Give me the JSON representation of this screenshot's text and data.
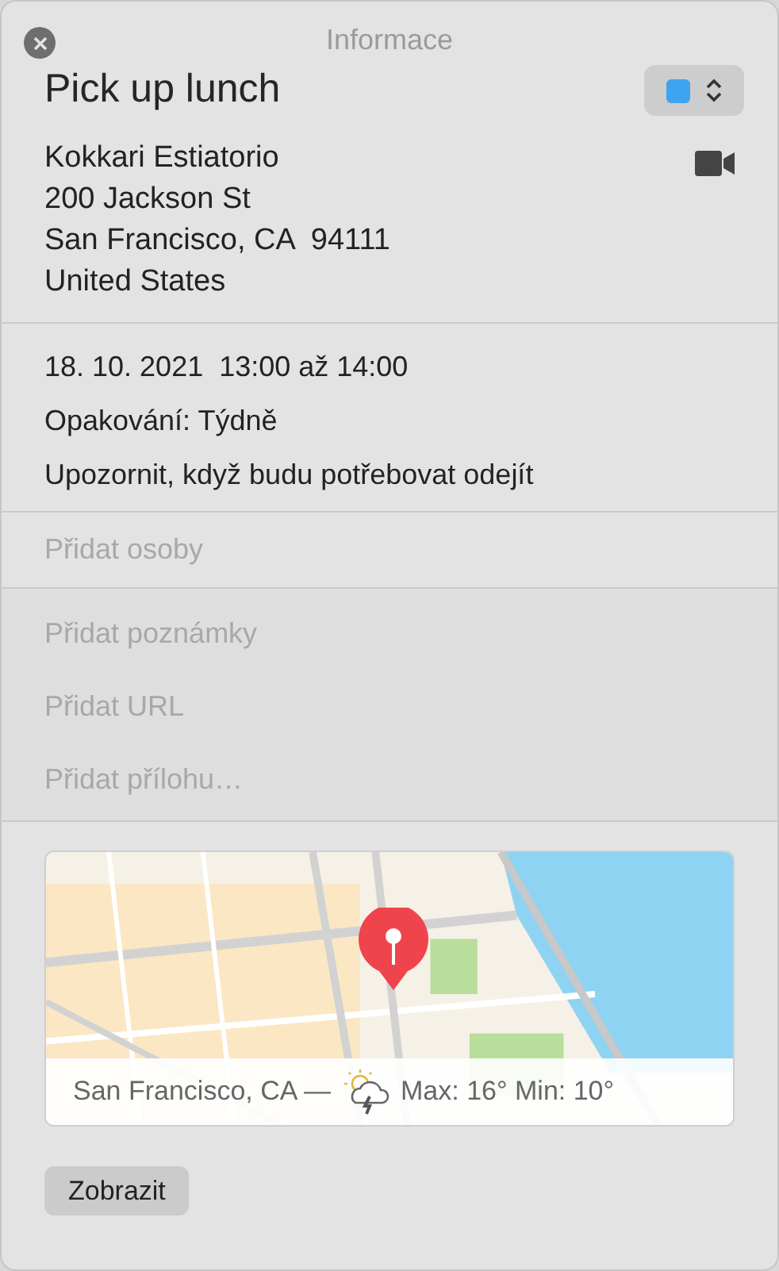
{
  "window": {
    "title": "Informace"
  },
  "event": {
    "title": "Pick up lunch",
    "color": "#3ea4f0"
  },
  "location": [
    "Kokkari Estiatorio",
    "200 Jackson St",
    "San Francisco, CA  94111",
    "United States"
  ],
  "details": [
    "18. 10. 2021  13:00 až 14:00",
    "Opakování: Týdně",
    "Upozornit, když budu potřebovat odejít"
  ],
  "invitees": {
    "placeholder": "Přidat osoby"
  },
  "extras": [
    {
      "placeholder": "Přidat poznámky"
    },
    {
      "placeholder": "Přidat URL"
    },
    {
      "placeholder": "Přidat přílohu…"
    }
  ],
  "map": {
    "kind": "picture",
    "weather_place": "San Francisco, CA —",
    "weather_temps": "Max: 16° Min: 10°"
  },
  "buttons": [
    "Zobrazit"
  ]
}
